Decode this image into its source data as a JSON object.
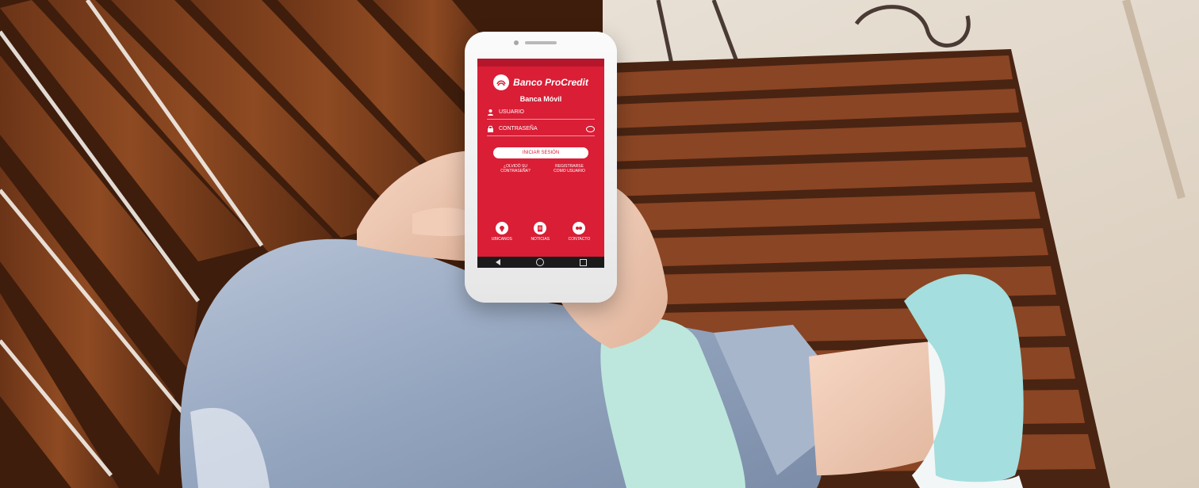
{
  "photo": {
    "description": "Person sitting on a wooden bench holding a smartphone showing the Banco ProCredit mobile banking login screen"
  },
  "phone_app": {
    "brand_name": "Banco ProCredit",
    "title": "Banca Móvil",
    "username_placeholder": "USUARIO",
    "password_placeholder": "CONTRASEÑA",
    "login_button": "INICIAR SESIÓN",
    "forgot_password": "¿OLVIDÓ SU CONTRASEÑA?",
    "register_link": "REGISTRARSE COMO USUARIO",
    "bottom_nav": [
      {
        "label": "UBICANOS",
        "icon": "location-icon"
      },
      {
        "label": "NOTICIAS",
        "icon": "news-icon"
      },
      {
        "label": "CONTACTO",
        "icon": "contact-icon"
      }
    ],
    "accent_color": "#d91e36"
  }
}
